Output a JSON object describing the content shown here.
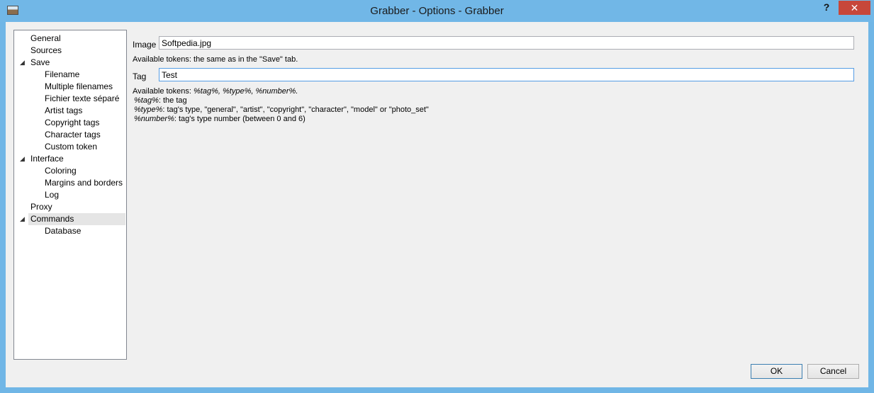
{
  "window": {
    "title": "Grabber - Options - Grabber",
    "help_label": "?",
    "close_label": "✕"
  },
  "tree": {
    "items": [
      {
        "label": "General",
        "level": 0
      },
      {
        "label": "Sources",
        "level": 0
      },
      {
        "label": "Save",
        "level": 0,
        "expanded": true
      },
      {
        "label": "Filename",
        "level": 1
      },
      {
        "label": "Multiple filenames",
        "level": 1
      },
      {
        "label": "Fichier texte séparé",
        "level": 1
      },
      {
        "label": "Artist tags",
        "level": 1
      },
      {
        "label": "Copyright tags",
        "level": 1
      },
      {
        "label": "Character tags",
        "level": 1
      },
      {
        "label": "Custom token",
        "level": 1
      },
      {
        "label": "Interface",
        "level": 0,
        "expanded": true
      },
      {
        "label": "Coloring",
        "level": 1
      },
      {
        "label": "Margins and borders",
        "level": 1
      },
      {
        "label": "Log",
        "level": 1
      },
      {
        "label": "Proxy",
        "level": 0
      },
      {
        "label": "Commands",
        "level": 0,
        "expanded": true,
        "selected": true
      },
      {
        "label": "Database",
        "level": 1
      }
    ],
    "expand_glyph": "◢"
  },
  "form": {
    "image_label": "Image",
    "image_value": "Softpedia.jpg",
    "image_note": "Available tokens: the same as in the \"Save\" tab.",
    "tag_label": "Tag",
    "tag_value": "Test",
    "tokens_prefix": "Available tokens: ",
    "tokens_list": "%tag%, %type%, %number%.",
    "tag_token": "%tag%",
    "tag_desc": ": the tag",
    "type_token": "%type%",
    "type_desc": ": tag's type, \"general\", \"artist\", \"copyright\", \"character\", \"model\" or \"photo_set\"",
    "number_token": "%number%",
    "number_desc": ": tag's type number (between 0 and 6)"
  },
  "buttons": {
    "ok": "OK",
    "cancel": "Cancel"
  },
  "colors": {
    "titlebar": "#71b7e7",
    "close": "#c7473a",
    "selection": "#e5e5e5"
  }
}
